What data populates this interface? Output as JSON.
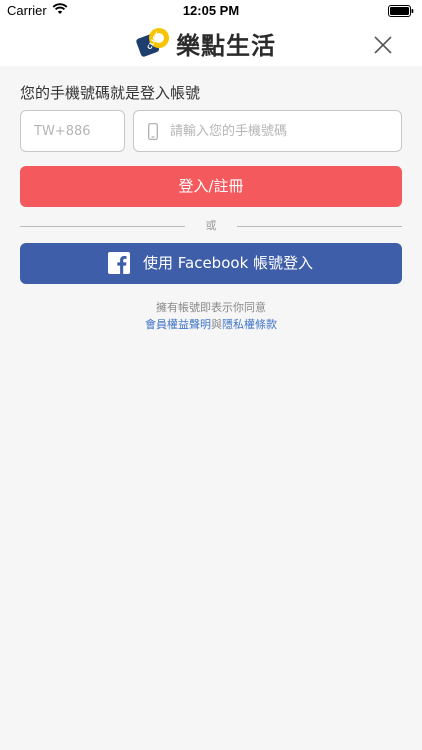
{
  "status_bar": {
    "carrier": "Carrier",
    "time": "12:05 PM"
  },
  "header": {
    "logo_text": "樂點生活",
    "logo_mark_text": "CLICK"
  },
  "form": {
    "prompt": "您的手機號碼就是登入帳號",
    "country_code_placeholder": "TW+886",
    "phone_placeholder": "請輸入您的手機號碼",
    "login_button": "登入/註冊",
    "divider_text": "或",
    "facebook_button": "使用 Facebook 帳號登入"
  },
  "terms": {
    "agree_text": "擁有帳號即表示你同意",
    "member_rights_link": "會員權益聲明",
    "conjunction": "與",
    "privacy_link": "隱私權條款"
  },
  "colors": {
    "login_button": "#f45a5d",
    "facebook_button": "#3f5ea9",
    "link": "#3f74c7",
    "background": "#f6f6f6"
  }
}
